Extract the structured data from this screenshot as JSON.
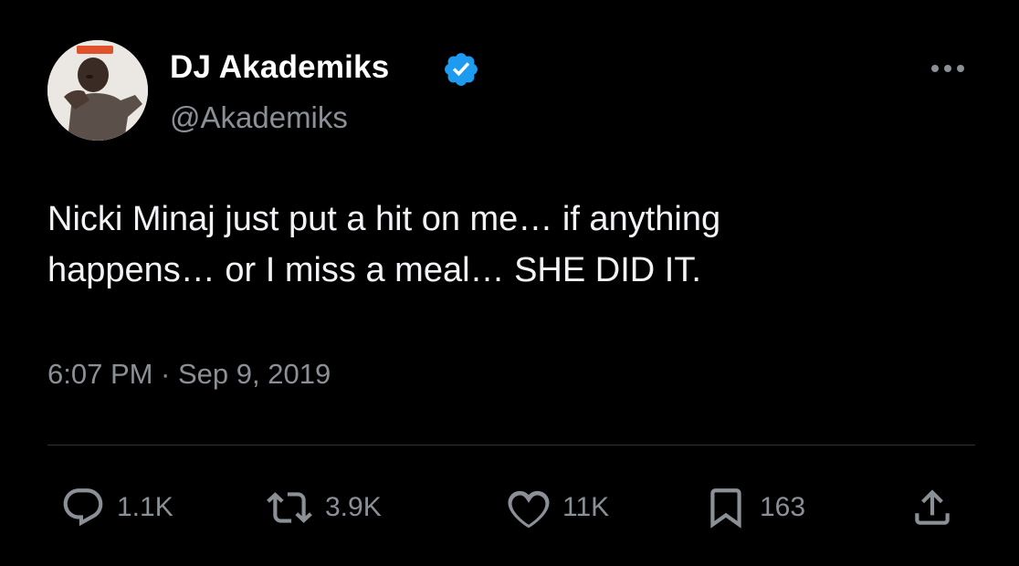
{
  "author": {
    "display_name": "DJ Akademiks",
    "handle": "@Akademiks",
    "verified": true,
    "verified_color": "#1d9bf0"
  },
  "tweet": {
    "text": "Nicki Minaj just put a hit on me… if anything\nhappens… or I miss a meal… SHE DID IT.",
    "timestamp": "6:07 PM · Sep 9, 2019"
  },
  "actions": {
    "replies": "1.1K",
    "reposts": "3.9K",
    "likes": "11K",
    "bookmarks": "163"
  },
  "icons": {
    "reply": "reply-bubble-icon",
    "repost": "repost-arrows-icon",
    "like": "heart-icon",
    "bookmark": "bookmark-icon",
    "share": "share-upload-icon",
    "more": "more-dots-icon"
  },
  "theme": {
    "background": "#000000",
    "text": "#ffffff",
    "secondary_text": "#8b9096",
    "divider": "#2f3336"
  }
}
